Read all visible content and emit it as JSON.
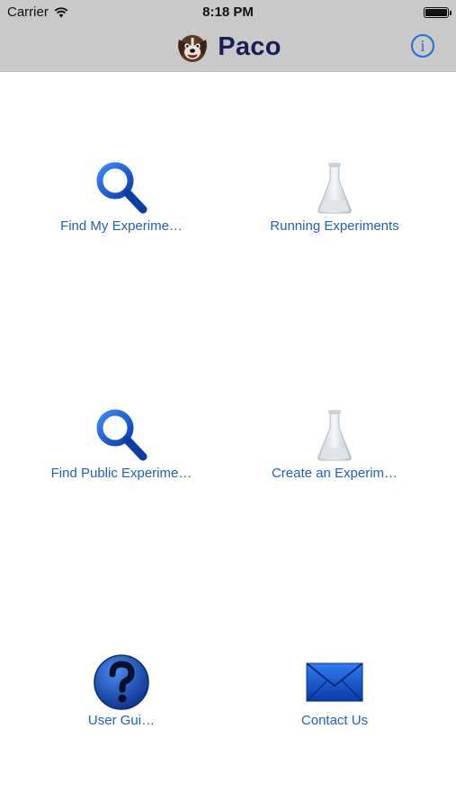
{
  "status_bar": {
    "carrier": "Carrier",
    "time": "8:18 PM"
  },
  "nav": {
    "title": "Paco",
    "info_label": "i"
  },
  "tiles": [
    {
      "label": "Find My Experime…",
      "icon": "magnifier-icon"
    },
    {
      "label": "Running Experiments",
      "icon": "flask-icon"
    },
    {
      "label": "Find Public Experime…",
      "icon": "magnifier-icon"
    },
    {
      "label": "Create an Experim…",
      "icon": "flask-icon"
    },
    {
      "label": "User Gui…",
      "icon": "question-icon"
    },
    {
      "label": "Contact Us",
      "icon": "envelope-icon"
    }
  ],
  "colors": {
    "header_bg": "#c9c9c9",
    "link_blue": "#1d5fc4",
    "title_navy": "#1a1f5a",
    "icon_blue": "#1f5fd0"
  }
}
